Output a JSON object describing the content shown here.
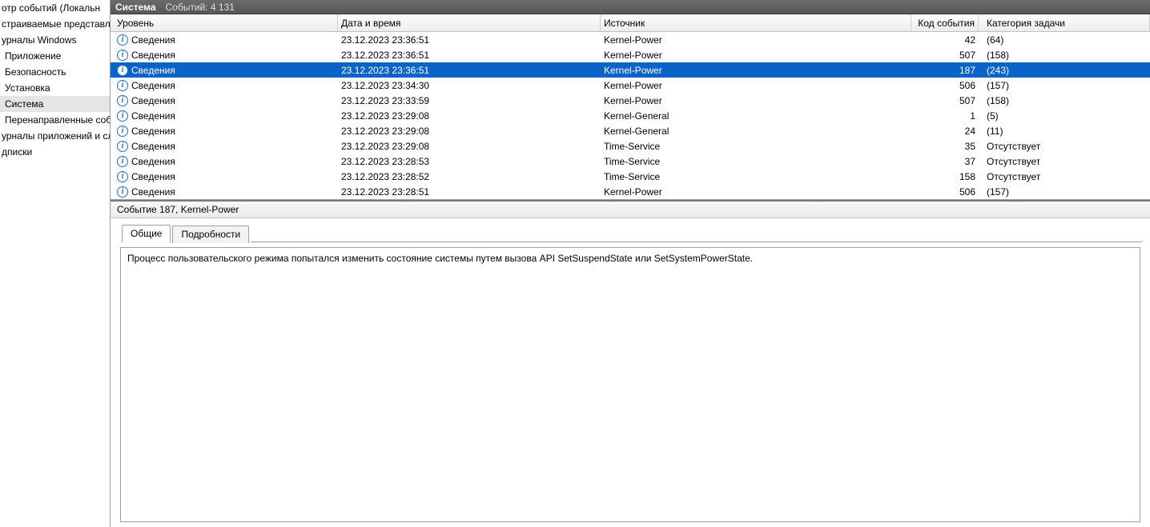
{
  "tree": {
    "items": [
      {
        "label": "отр событий (Локальн",
        "indent": 0,
        "selected": false
      },
      {
        "label": "страиваемые представле",
        "indent": 0,
        "selected": false
      },
      {
        "label": "урналы Windows",
        "indent": 0,
        "selected": false
      },
      {
        "label": "Приложение",
        "indent": 1,
        "selected": false
      },
      {
        "label": "Безопасность",
        "indent": 1,
        "selected": false
      },
      {
        "label": "Установка",
        "indent": 1,
        "selected": false
      },
      {
        "label": "Система",
        "indent": 1,
        "selected": true
      },
      {
        "label": "Перенаправленные соб",
        "indent": 1,
        "selected": false
      },
      {
        "label": "урналы приложений и сл",
        "indent": 0,
        "selected": false
      },
      {
        "label": "дписки",
        "indent": 0,
        "selected": false
      }
    ]
  },
  "titlebar": {
    "title": "Система",
    "count_label": "Событий: 4 131"
  },
  "columns": {
    "level": "Уровень",
    "date": "Дата и время",
    "source": "Источник",
    "event_id": "Код события",
    "category": "Категория задачи"
  },
  "rows": [
    {
      "level": "Сведения",
      "date": "23.12.2023 23:36:51",
      "source": "Kernel-Power",
      "id": "42",
      "cat": "(64)",
      "selected": false
    },
    {
      "level": "Сведения",
      "date": "23.12.2023 23:36:51",
      "source": "Kernel-Power",
      "id": "507",
      "cat": "(158)",
      "selected": false
    },
    {
      "level": "Сведения",
      "date": "23.12.2023 23:36:51",
      "source": "Kernel-Power",
      "id": "187",
      "cat": "(243)",
      "selected": true
    },
    {
      "level": "Сведения",
      "date": "23.12.2023 23:34:30",
      "source": "Kernel-Power",
      "id": "506",
      "cat": "(157)",
      "selected": false
    },
    {
      "level": "Сведения",
      "date": "23.12.2023 23:33:59",
      "source": "Kernel-Power",
      "id": "507",
      "cat": "(158)",
      "selected": false
    },
    {
      "level": "Сведения",
      "date": "23.12.2023 23:29:08",
      "source": "Kernel-General",
      "id": "1",
      "cat": "(5)",
      "selected": false
    },
    {
      "level": "Сведения",
      "date": "23.12.2023 23:29:08",
      "source": "Kernel-General",
      "id": "24",
      "cat": "(11)",
      "selected": false
    },
    {
      "level": "Сведения",
      "date": "23.12.2023 23:29:08",
      "source": "Time-Service",
      "id": "35",
      "cat": "Отсутствует",
      "selected": false
    },
    {
      "level": "Сведения",
      "date": "23.12.2023 23:28:53",
      "source": "Time-Service",
      "id": "37",
      "cat": "Отсутствует",
      "selected": false
    },
    {
      "level": "Сведения",
      "date": "23.12.2023 23:28:52",
      "source": "Time-Service",
      "id": "158",
      "cat": "Отсутствует",
      "selected": false
    },
    {
      "level": "Сведения",
      "date": "23.12.2023 23:28:51",
      "source": "Kernel-Power",
      "id": "506",
      "cat": "(157)",
      "selected": false
    }
  ],
  "detail": {
    "title": "Событие 187, Kernel-Power",
    "tabs": {
      "general": "Общие",
      "details": "Подробности"
    },
    "message": "Процесс пользовательского режима попытался изменить состояние системы путем вызова API SetSuspendState или SetSystemPowerState."
  }
}
